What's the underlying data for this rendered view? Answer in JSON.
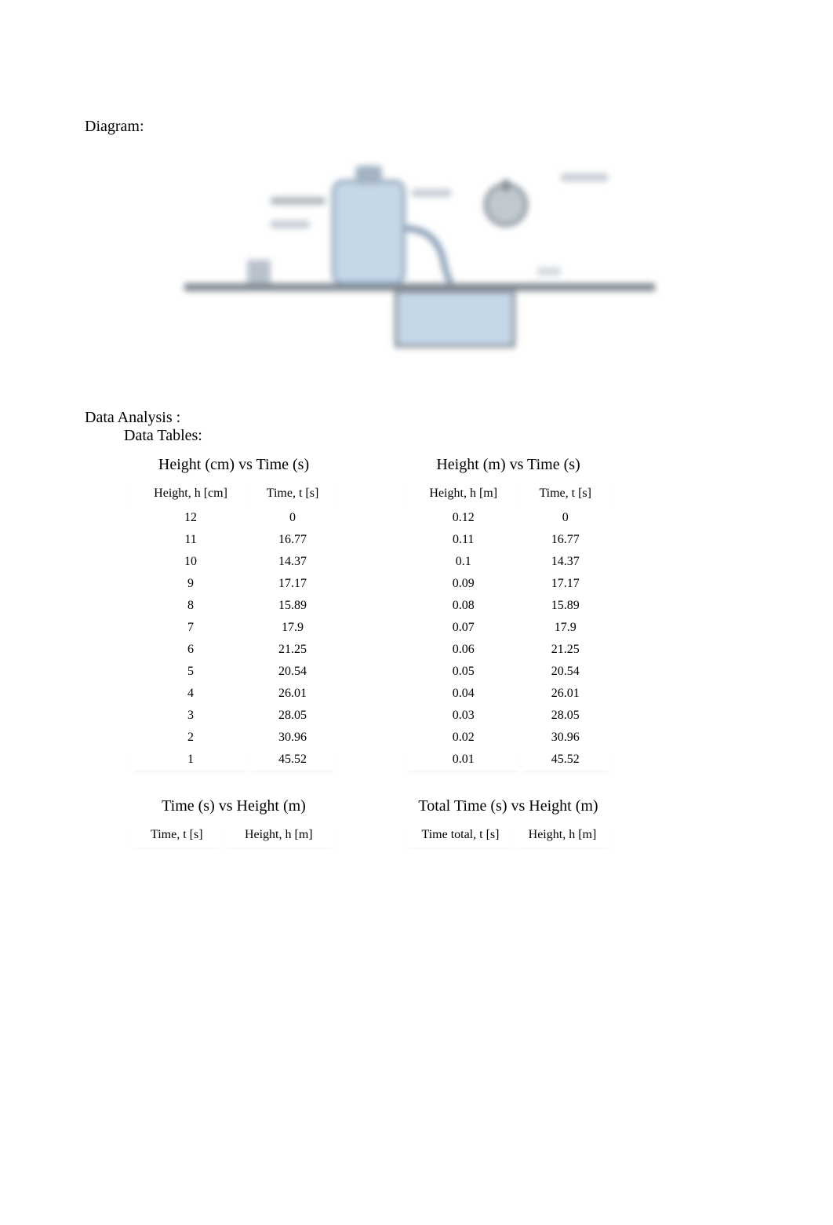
{
  "sections": {
    "diagram_heading": "Diagram:",
    "data_analysis_heading": "Data Analysis :",
    "data_tables_heading": "Data Tables:"
  },
  "table1": {
    "title": "Height (cm) vs Time (s)",
    "col1": "Height, h [cm]",
    "col2": "Time, t [s]",
    "rows": [
      {
        "h": "12",
        "t": "0"
      },
      {
        "h": "11",
        "t": "16.77"
      },
      {
        "h": "10",
        "t": "14.37"
      },
      {
        "h": "9",
        "t": "17.17"
      },
      {
        "h": "8",
        "t": "15.89"
      },
      {
        "h": "7",
        "t": "17.9"
      },
      {
        "h": "6",
        "t": "21.25"
      },
      {
        "h": "5",
        "t": "20.54"
      },
      {
        "h": "4",
        "t": "26.01"
      },
      {
        "h": "3",
        "t": "28.05"
      },
      {
        "h": "2",
        "t": "30.96"
      },
      {
        "h": "1",
        "t": "45.52"
      }
    ]
  },
  "table2": {
    "title": "Height (m) vs Time (s)",
    "col1": "Height, h [m]",
    "col2": "Time, t [s]",
    "rows": [
      {
        "h": "0.12",
        "t": "0"
      },
      {
        "h": "0.11",
        "t": "16.77"
      },
      {
        "h": "0.1",
        "t": "14.37"
      },
      {
        "h": "0.09",
        "t": "17.17"
      },
      {
        "h": "0.08",
        "t": "15.89"
      },
      {
        "h": "0.07",
        "t": "17.9"
      },
      {
        "h": "0.06",
        "t": "21.25"
      },
      {
        "h": "0.05",
        "t": "20.54"
      },
      {
        "h": "0.04",
        "t": "26.01"
      },
      {
        "h": "0.03",
        "t": "28.05"
      },
      {
        "h": "0.02",
        "t": "30.96"
      },
      {
        "h": "0.01",
        "t": "45.52"
      }
    ]
  },
  "table3": {
    "title": "Time (s) vs Height (m)",
    "col1": "Time, t [s]",
    "col2": "Height, h [m]"
  },
  "table4": {
    "title": "Total Time (s) vs Height (m)",
    "col1": "Time total, t [s]",
    "col2": "Height, h [m]"
  }
}
